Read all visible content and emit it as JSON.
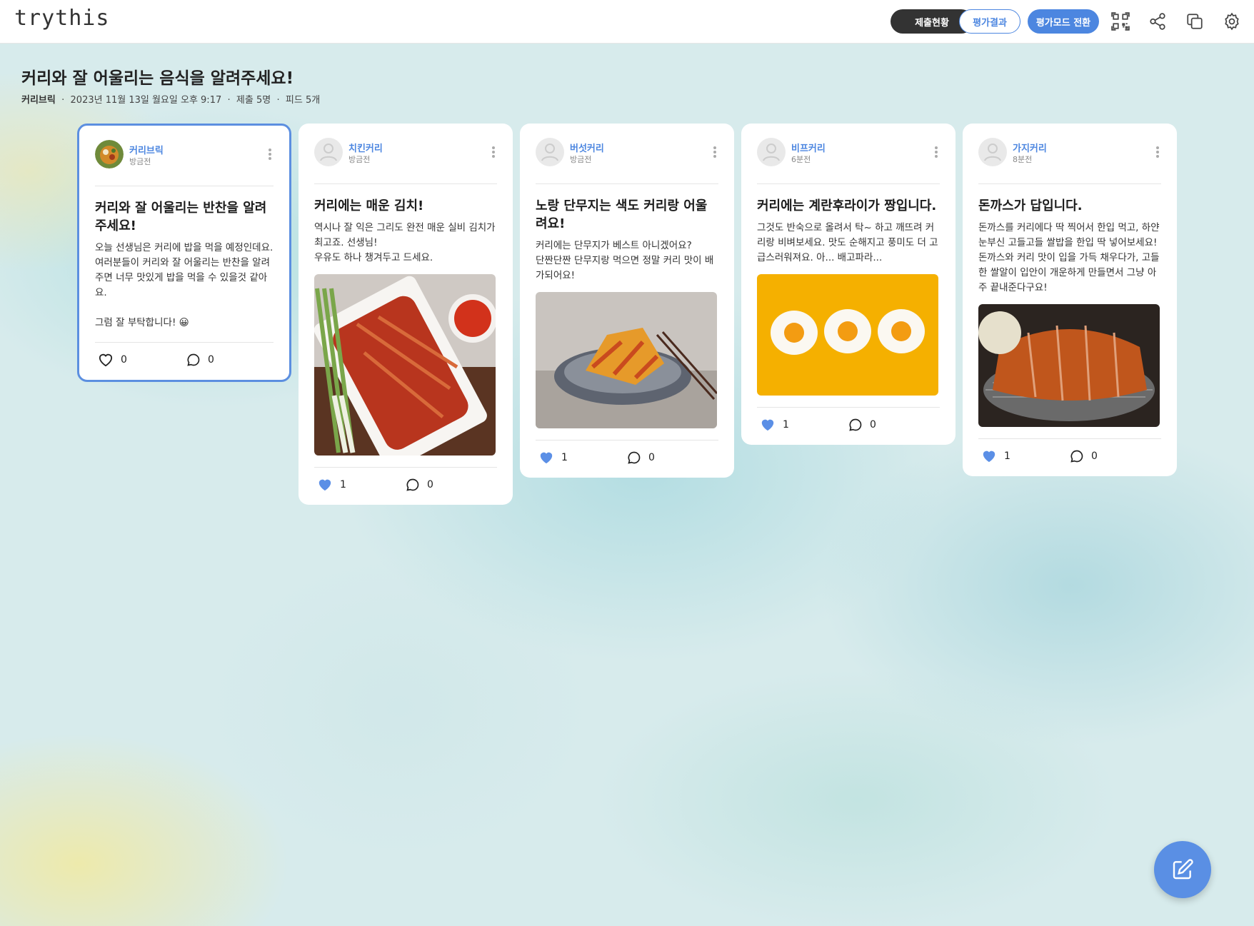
{
  "app": {
    "logo": "trythis"
  },
  "toolbar": {
    "submit_status": "제출현황",
    "eval_result": "평가결과",
    "eval_mode": "평가모드 전환"
  },
  "board": {
    "title": "커리와 잘 어울리는 음식을 알려주세요!",
    "author": "커리브릭",
    "date": "2023년 11월 13일 월요일 오후 9:17",
    "submissions": "제출 5명",
    "feeds": "피드 5개"
  },
  "cards": [
    {
      "author": "커리브릭",
      "time": "방금전",
      "title": "커리와 잘 어울리는 반찬을 알려주세요!",
      "body": "오늘 선생님은 커리에 밥을 먹을 예정인데요.\n여러분들이 커리와 잘 어울리는 반찬을 알려주면 너무 맛있게 밥을 먹을 수 있을것 같아요.\n\n그럼 잘 부탁합니다! 😀",
      "likes": "0",
      "comments": "0",
      "liked": false
    },
    {
      "author": "치킨커리",
      "time": "방금전",
      "title": "커리에는 매운 김치!",
      "body": "역시나 잘 익은 그리도 완전 매운 실비 김치가 최고죠. 선생님!\n우유도 하나 챙겨두고 드세요.",
      "likes": "1",
      "comments": "0",
      "liked": true
    },
    {
      "author": "버섯커리",
      "time": "방금전",
      "title": "노랑 단무지는 색도 커리랑 어울려요!",
      "body": "커리에는 단무지가 베스트 아니겠어요?\n단짠단짠 단무지랑 먹으면 정말 커리 맛이 배가되어요!",
      "likes": "1",
      "comments": "0",
      "liked": true
    },
    {
      "author": "비프커리",
      "time": "6분전",
      "title": "커리에는 계란후라이가 짱입니다.",
      "body": "그것도 반숙으로 올려서 탁~ 하고 깨뜨려 커리랑 비벼보세요. 맛도 순해지고 풍미도 더 고급스러워져요. 아... 배고파라...",
      "likes": "1",
      "comments": "0",
      "liked": true
    },
    {
      "author": "가지커리",
      "time": "8분전",
      "title": "돈까스가 답입니다.",
      "body": "돈까스를 커리에다 딱 찍어서 한입 먹고, 하얀 눈부신 고들고들 쌀밥을 한입 딱 넣어보세요! 돈까스와 커리 맛이 입을 가득 채우다가, 고들한 쌀알이 입안이 개운하게 만들면서 그냥 아주 끝내준다구요!",
      "likes": "1",
      "comments": "0",
      "liked": true
    }
  ],
  "colors": {
    "accent": "#4c86e0",
    "dark": "#333333",
    "heart": "#5b8fe6"
  },
  "icons": [
    "qr-code-icon",
    "share-icon",
    "copy-icon",
    "gear-icon",
    "kebab-icon",
    "heart-icon",
    "comment-icon",
    "edit-icon"
  ]
}
